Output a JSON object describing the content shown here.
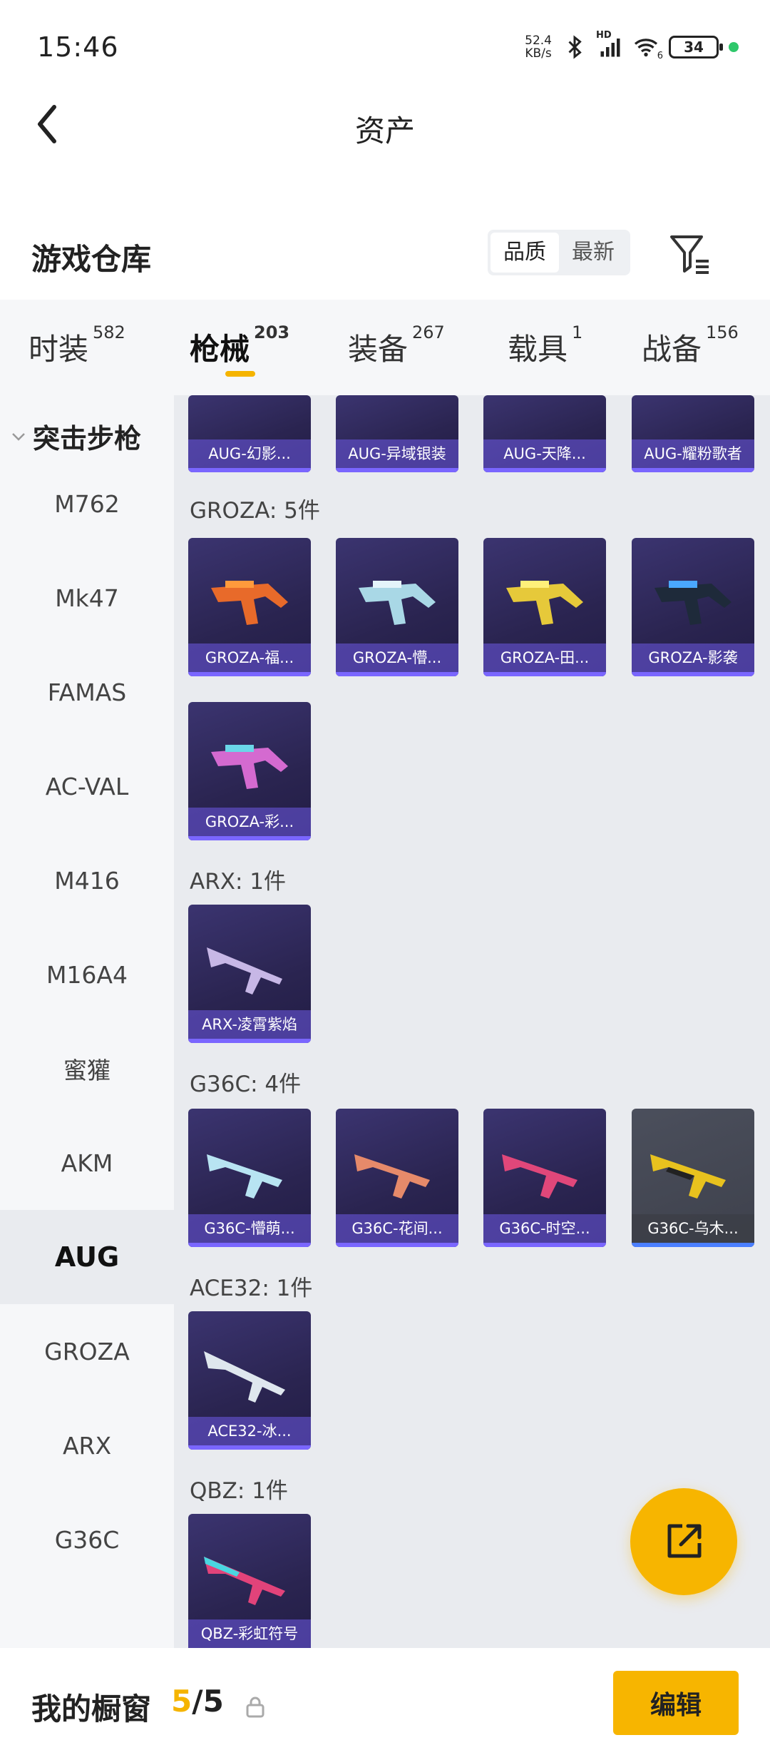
{
  "status_bar": {
    "time": "15:46",
    "speed_value": "52.4",
    "speed_unit": "KB/s",
    "network_tag": "HD",
    "wifi_tag": "6",
    "battery": "34"
  },
  "header": {
    "title": "资产"
  },
  "warehouse": {
    "title": "游戏仓库",
    "sort_options": [
      "品质",
      "最新"
    ],
    "sort_active": "品质"
  },
  "tabs": [
    {
      "label": "时装",
      "count": "582"
    },
    {
      "label": "枪械",
      "count": "203"
    },
    {
      "label": "装备",
      "count": "267"
    },
    {
      "label": "载具",
      "count": "1"
    },
    {
      "label": "战备",
      "count": "156"
    }
  ],
  "sidebar": {
    "heading": "突击步枪",
    "items": [
      "M762",
      "Mk47",
      "FAMAS",
      "AC-VAL",
      "M416",
      "M16A4",
      "蜜獾",
      "AKM",
      "AUG",
      "GROZA",
      "ARX",
      "G36C"
    ],
    "active": "AUG"
  },
  "groups": [
    {
      "label": "",
      "items": [
        "AUG-幻影...",
        "AUG-异域银装",
        "AUG-天降...",
        "AUG-耀粉歌者"
      ]
    },
    {
      "label": "GROZA: 5件",
      "items": [
        "GROZA-福...",
        "GROZA-懵...",
        "GROZA-田...",
        "GROZA-影袭",
        "GROZA-彩..."
      ]
    },
    {
      "label": "ARX: 1件",
      "items": [
        "ARX-凌霄紫焰"
      ]
    },
    {
      "label": "G36C: 4件",
      "items": [
        "G36C-懵萌...",
        "G36C-花间...",
        "G36C-时空...",
        "G36C-乌木..."
      ]
    },
    {
      "label": "ACE32: 1件",
      "items": [
        "ACE32-冰..."
      ]
    },
    {
      "label": "QBZ: 1件",
      "items": [
        "QBZ-彩虹符号"
      ]
    }
  ],
  "bottom_bar": {
    "label": "我的橱窗",
    "current": "5",
    "total": "/5",
    "edit": "编辑"
  },
  "colors": {
    "accent": "#f7b500",
    "card_bg": "#2a2450",
    "content_bg": "#e9ebef"
  }
}
